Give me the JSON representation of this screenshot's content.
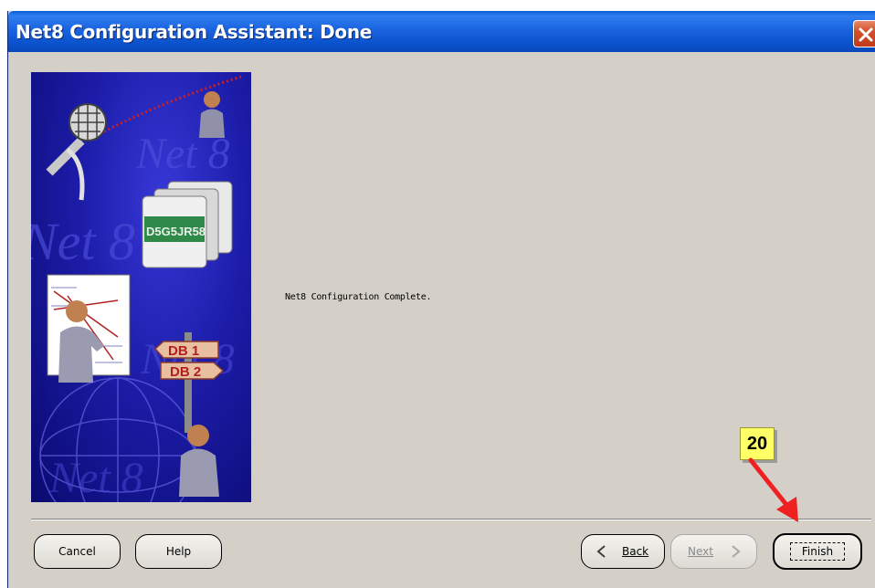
{
  "window": {
    "title": "Net8 Configuration Assistant: Done",
    "close_icon": "close-icon"
  },
  "side_image": {
    "watermark_text": "Net 8",
    "folder_label": "D5G5JR58",
    "signpost_labels": [
      "DB 1",
      "DB 2"
    ]
  },
  "main": {
    "message": "Net8 Configuration Complete."
  },
  "footer": {
    "cancel_label": "Cancel",
    "help_label": "Help",
    "back_label": "Back",
    "next_label": "Next",
    "finish_label": "Finish"
  },
  "annotation": {
    "step_number": "20",
    "badge_color": "#ffff66",
    "arrow_color": "#ee2020"
  },
  "colors": {
    "titlebar": "#0b52cc",
    "dialog_bg": "#d4d0c8",
    "close_button": "#d2512c"
  }
}
